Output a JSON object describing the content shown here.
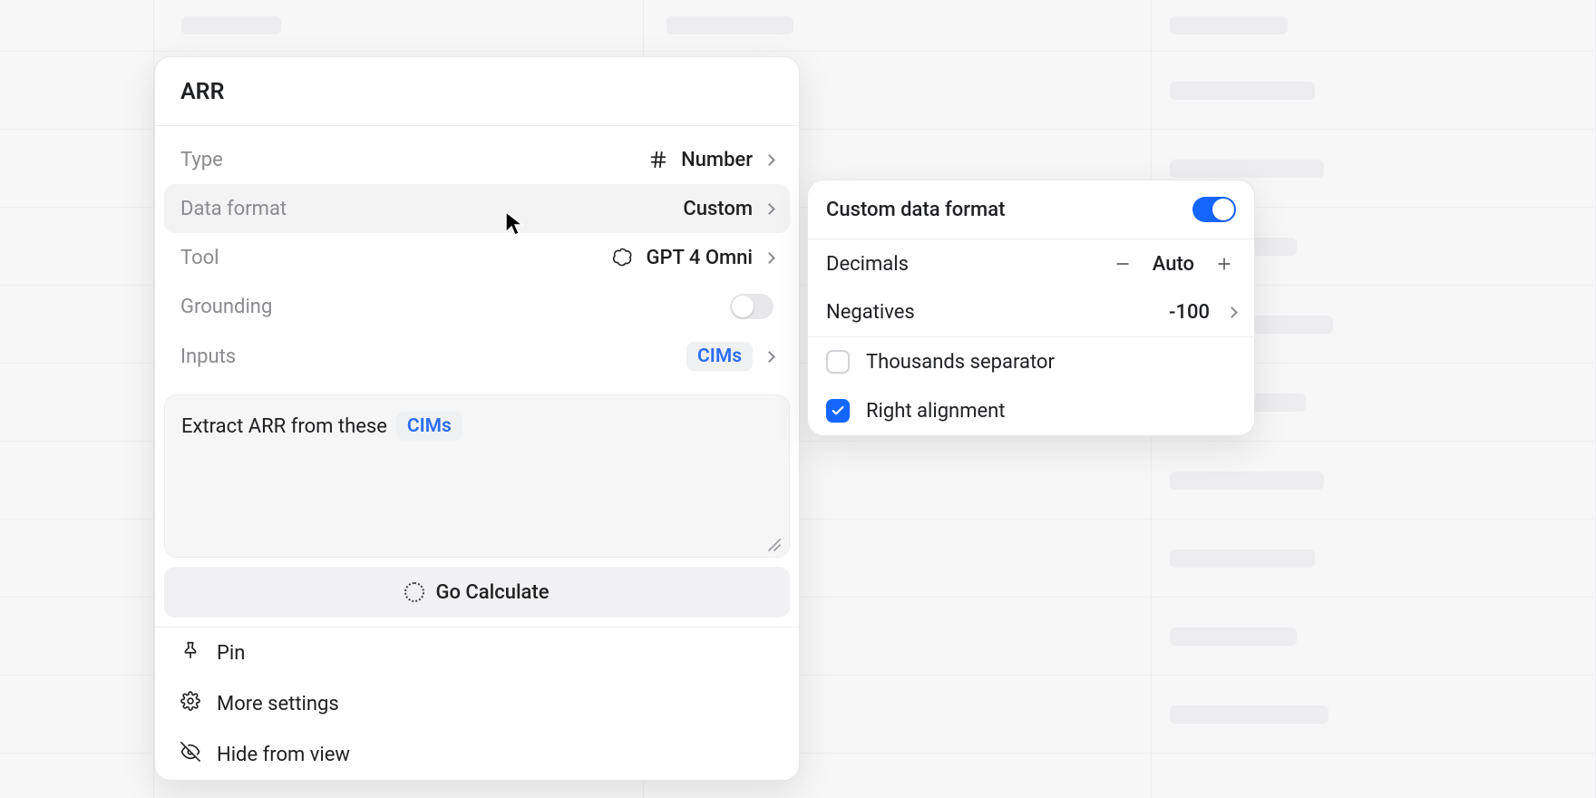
{
  "panel": {
    "title": "ARR",
    "type": {
      "label": "Type",
      "value": "Number"
    },
    "data_format": {
      "label": "Data format",
      "value": "Custom"
    },
    "tool": {
      "label": "Tool",
      "value": "GPT 4 Omni"
    },
    "grounding": {
      "label": "Grounding",
      "on": false
    },
    "inputs": {
      "label": "Inputs",
      "tag": "CIMs"
    },
    "prompt": {
      "prefix": "Extract ARR from these",
      "tag": "CIMs"
    },
    "calc_label": "Go Calculate",
    "menu": {
      "pin": "Pin",
      "more": "More settings",
      "hide": "Hide from view"
    }
  },
  "flyout": {
    "title": "Custom data format",
    "on": true,
    "decimals": {
      "label": "Decimals",
      "value": "Auto"
    },
    "negatives": {
      "label": "Negatives",
      "value": "-100"
    },
    "thousands": {
      "label": "Thousands separator",
      "checked": false
    },
    "right_align": {
      "label": "Right alignment",
      "checked": true
    }
  }
}
